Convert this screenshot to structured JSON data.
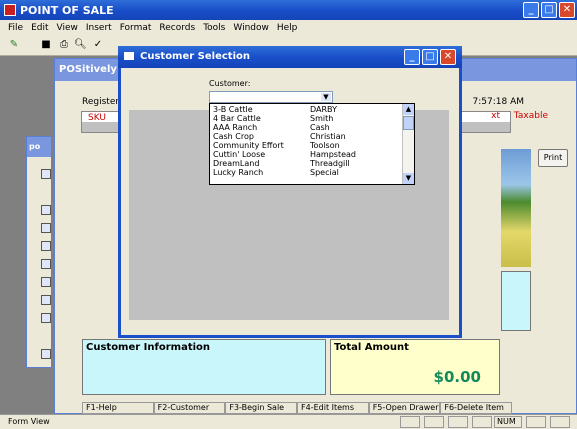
{
  "app": {
    "title": "POINT OF SALE"
  },
  "menu": [
    "File",
    "Edit",
    "View",
    "Insert",
    "Format",
    "Records",
    "Tools",
    "Window",
    "Help"
  ],
  "pos": {
    "title": "POSitively Bu",
    "register_label": "Register:",
    "time": "7:57:18 AM",
    "col_sku": "SKU",
    "col_ext": "xt",
    "col_taxable": "Taxable",
    "print_label": "Print",
    "customer_info_label": "Customer Information",
    "total_label": "Total Amount",
    "total_value": "$0.00",
    "fkeys": [
      "F1-Help",
      "F2-Customer",
      "F3-Begin Sale",
      "F4-Edit Items",
      "F5-Open Drawer",
      "F6-Delete Item"
    ]
  },
  "side_panel": {
    "title": "po"
  },
  "dialog": {
    "title": "Customer Selection",
    "customer_label": "Customer:",
    "customers": [
      {
        "name": "3-B Cattle",
        "contact": "DARBY"
      },
      {
        "name": "4 Bar Cattle",
        "contact": "Smith"
      },
      {
        "name": "AAA Ranch",
        "contact": "Cash"
      },
      {
        "name": "Cash Crop",
        "contact": "Christian"
      },
      {
        "name": "Community Effort",
        "contact": "Toolson"
      },
      {
        "name": "Cuttin' Loose",
        "contact": "Hampstead"
      },
      {
        "name": "DreamLand",
        "contact": "Threadgill"
      },
      {
        "name": "Lucky Ranch",
        "contact": "Special"
      }
    ]
  },
  "statusbar": {
    "left": "Form View",
    "num": "NUM"
  },
  "colors": {
    "titlebar": "#1a4fc9",
    "customer_info_bg": "#c8f6fb",
    "total_bg": "#ffffcc",
    "total_text": "#138a5a"
  }
}
